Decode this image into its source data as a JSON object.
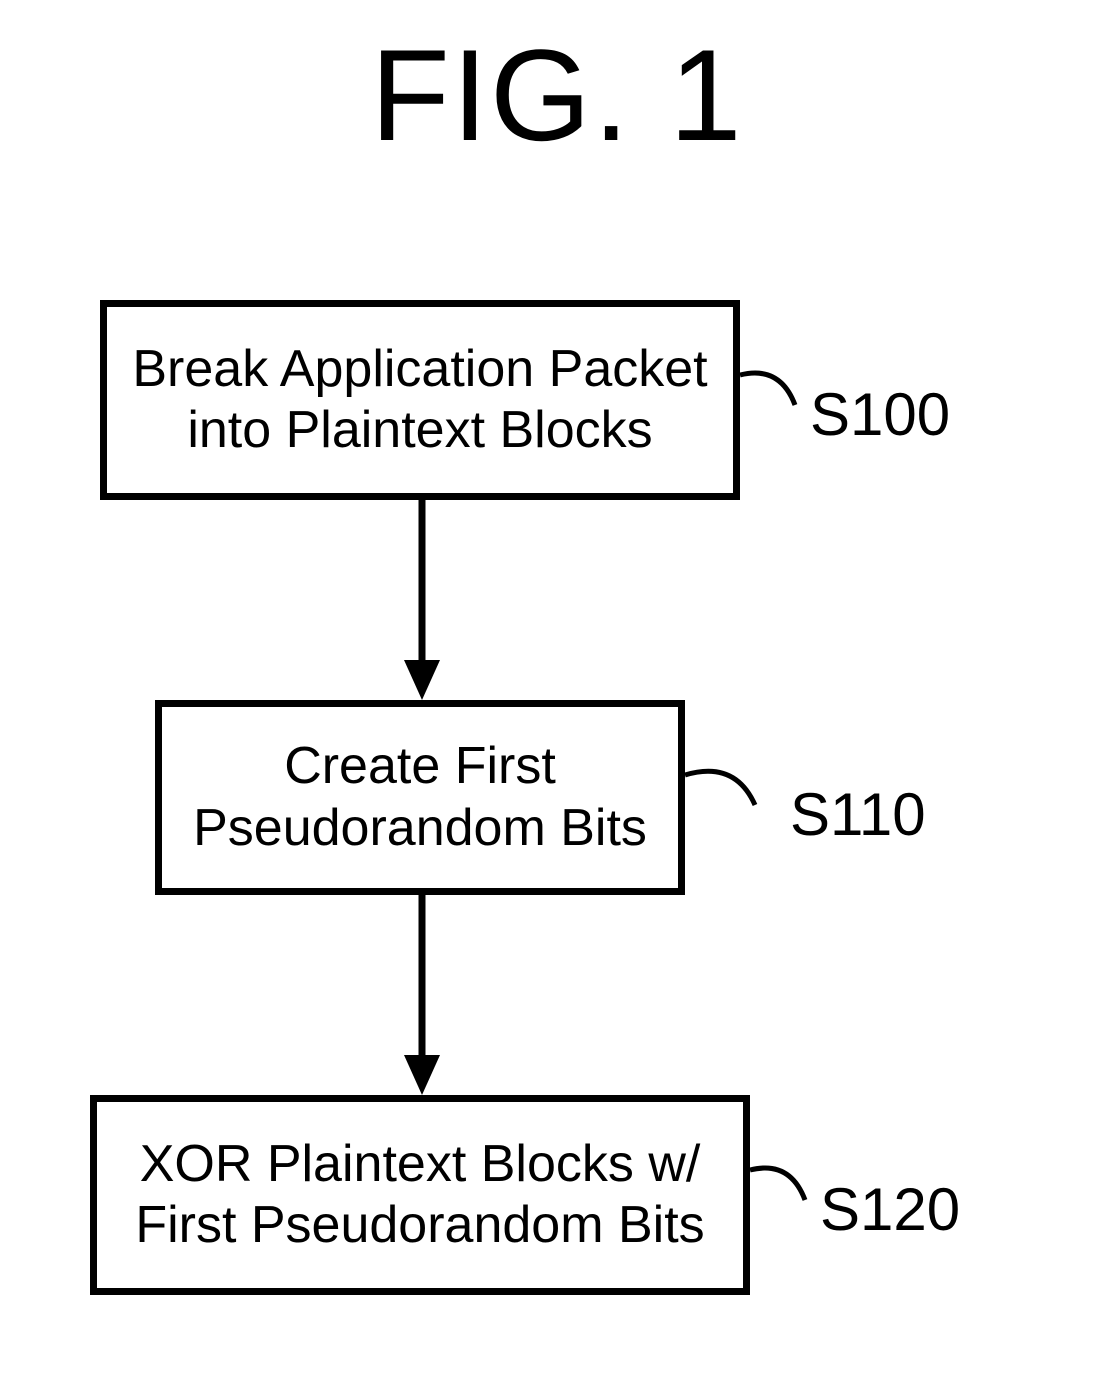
{
  "figure": {
    "title": "FIG. 1",
    "steps": [
      {
        "id": "S100",
        "label": "S100",
        "text_line1": "Break Application Packet",
        "text_line2": "into Plaintext Blocks"
      },
      {
        "id": "S110",
        "label": "S110",
        "text_line1": "Create First",
        "text_line2": "Pseudorandom Bits"
      },
      {
        "id": "S120",
        "label": "S120",
        "text_line1": "XOR Plaintext Blocks w/",
        "text_line2": "First Pseudorandom Bits"
      }
    ]
  }
}
